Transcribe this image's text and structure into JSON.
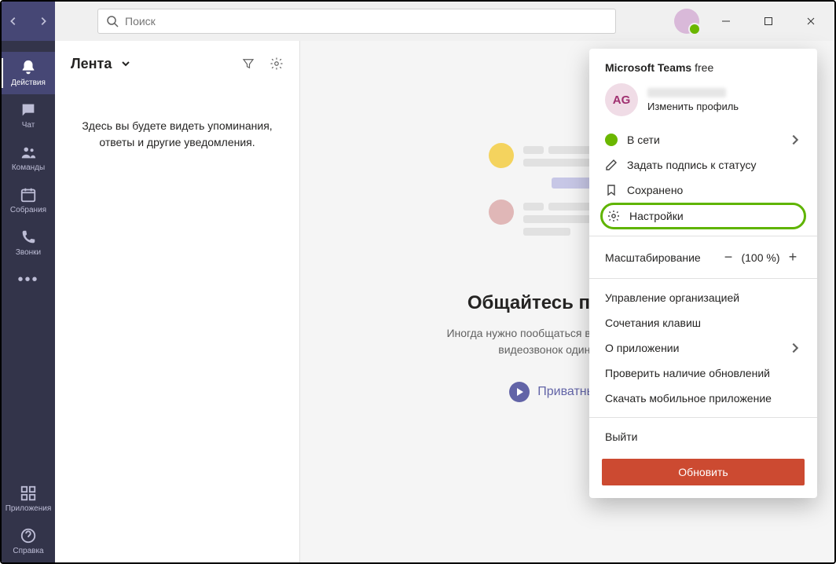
{
  "search": {
    "placeholder": "Поиск"
  },
  "rail": {
    "activity": "Действия",
    "chat": "Чат",
    "teams": "Команды",
    "meetings": "Собрания",
    "calls": "Звонки",
    "apps": "Приложения",
    "help": "Справка"
  },
  "feed": {
    "title": "Лента",
    "empty": "Здесь вы будете видеть упоминания, ответы и другие уведомления."
  },
  "center": {
    "heading": "Общайтесь приватно",
    "sub": "Иногда нужно пообщаться в чате или провести видеозвонок один на один.",
    "link": "Приватный чат"
  },
  "menu": {
    "brand": "Microsoft Teams",
    "plan": "free",
    "initials": "AG",
    "change_profile": "Изменить профиль",
    "status": "В сети",
    "set_status_message": "Задать подпись к статусу",
    "saved": "Сохранено",
    "settings": "Настройки",
    "zoom_label": "Масштабирование",
    "zoom_pct": "(100 %)",
    "manage_org": "Управление организацией",
    "shortcuts": "Сочетания клавиш",
    "about": "О приложении",
    "check_updates": "Проверить наличие обновлений",
    "download_mobile": "Скачать мобильное приложение",
    "sign_out": "Выйти",
    "upgrade": "Обновить"
  }
}
